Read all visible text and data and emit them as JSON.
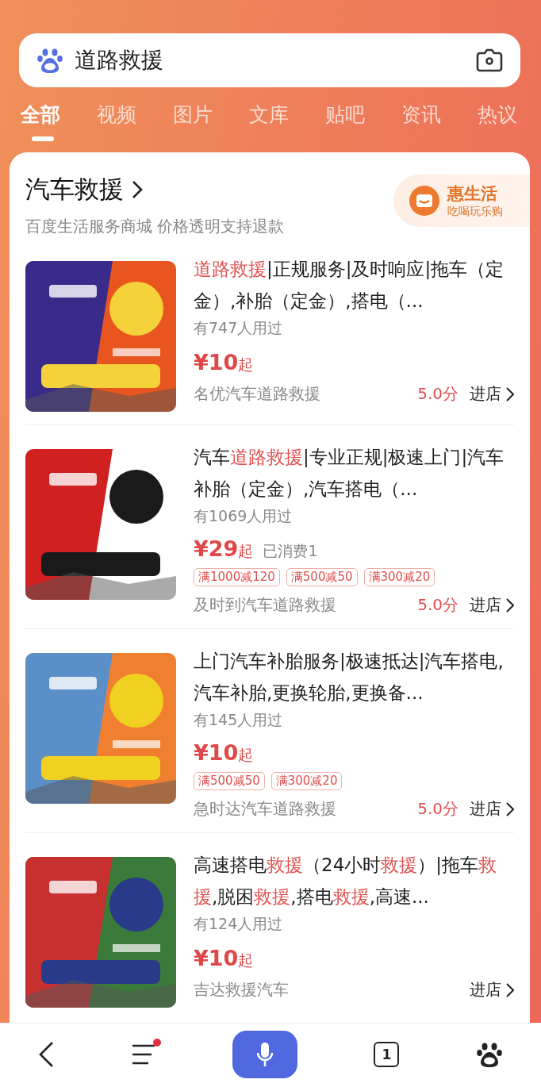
{
  "search": {
    "value": "道路救援"
  },
  "tabs": [
    {
      "label": "全部",
      "selected": true
    },
    {
      "label": "视频",
      "selected": false
    },
    {
      "label": "图片",
      "selected": false
    },
    {
      "label": "文库",
      "selected": false
    },
    {
      "label": "贴吧",
      "selected": false
    },
    {
      "label": "资讯",
      "selected": false
    },
    {
      "label": "热议",
      "selected": false
    }
  ],
  "card": {
    "title": "汽车救援",
    "subtitle": "百度生活服务商城 价格透明支持退款",
    "badge": {
      "title": "惠生活",
      "subtitle": "吃喝玩乐购"
    },
    "items": [
      {
        "image": {
          "kind": "picture"
        },
        "title": [
          {
            "text": "道路救援",
            "highlight": true
          },
          {
            "text": "|正规服务|及时响应|拖车（定金）,补胎（定金）,搭电（...",
            "highlight": false
          }
        ],
        "users": "有747人用过",
        "price": "¥10",
        "price_suffix": "起",
        "shop": "名优汽车道路救援",
        "rating": "5.0分",
        "enter": "进店"
      },
      {
        "image": {
          "kind": "picture"
        },
        "title": [
          {
            "text": "汽车",
            "highlight": false
          },
          {
            "text": "道路救援",
            "highlight": true
          },
          {
            "text": "|专业正规|极速上门|汽车补胎（定金）,汽车搭电（...",
            "highlight": false
          }
        ],
        "users": "有1069人用过",
        "price": "¥29",
        "price_suffix": "起",
        "sold": "已消费1",
        "coupons": [
          "满1000减120",
          "满500减50",
          "满300减20"
        ],
        "shop": "及时到汽车道路救援",
        "rating": "5.0分",
        "enter": "进店"
      },
      {
        "image": {
          "kind": "picture"
        },
        "title": [
          {
            "text": "上门汽车补胎服务|极速抵达|汽车搭电,汽车补胎,更换轮胎,更换备...",
            "highlight": false
          }
        ],
        "users": "有145人用过",
        "price": "¥10",
        "price_suffix": "起",
        "coupons": [
          "满500减50",
          "满300减20"
        ],
        "shop": "急时达汽车道路救援",
        "rating": "5.0分",
        "enter": "进店"
      },
      {
        "image": {
          "kind": "picture"
        },
        "title": [
          {
            "text": "高速搭电",
            "highlight": false
          },
          {
            "text": "救援",
            "highlight": true
          },
          {
            "text": "（24小时",
            "highlight": false
          },
          {
            "text": "救援",
            "highlight": true
          },
          {
            "text": "）|拖车",
            "highlight": false
          },
          {
            "text": "救援",
            "highlight": true
          },
          {
            "text": ",脱困",
            "highlight": false
          },
          {
            "text": "救援",
            "highlight": true
          },
          {
            "text": ",搭电",
            "highlight": false
          },
          {
            "text": "救援",
            "highlight": true
          },
          {
            "text": ",高速...",
            "highlight": false
          }
        ],
        "users": "有124人用过",
        "price": "¥10",
        "price_suffix": "起",
        "shop": "吉达救援汽车",
        "enter": "进店"
      }
    ]
  },
  "nav": {
    "menu_badge": true,
    "tab_count": "1"
  }
}
